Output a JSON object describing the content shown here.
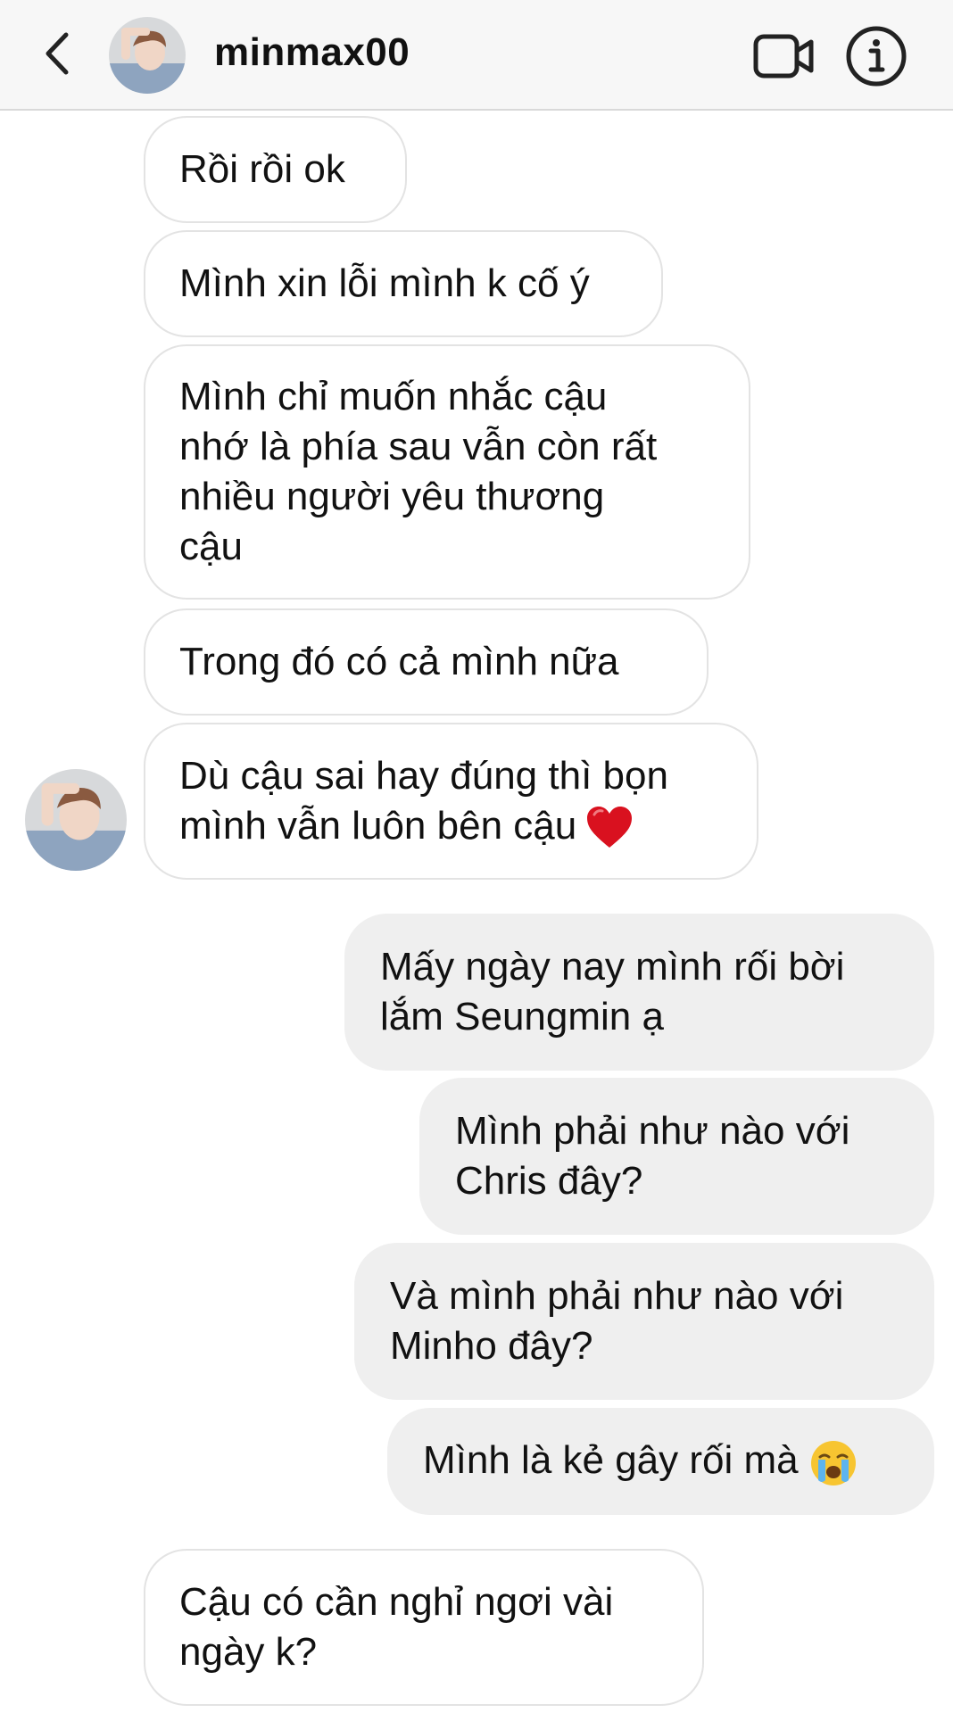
{
  "header": {
    "username": "minmax00",
    "icons": [
      "chevron-left-icon",
      "video-camera-icon",
      "info-icon"
    ]
  },
  "messages": [
    {
      "direction": "incoming",
      "text": "Rồi rồi ok"
    },
    {
      "direction": "incoming",
      "text": "Mình xin lỗi mình k cố ý"
    },
    {
      "direction": "incoming",
      "text": "Mình chỉ muốn nhắc cậu\nnhớ là phía sau vẫn còn rất\nnhiều người yêu thương\ncậu"
    },
    {
      "direction": "incoming",
      "text": "Trong đó có cả mình nữa"
    },
    {
      "direction": "incoming",
      "text": "Dù cậu sai hay đúng thì bọn\nmình vẫn luôn bên cậu",
      "emoji": "heart-emoji"
    },
    {
      "direction": "outgoing",
      "text": "Mấy ngày nay mình rối bời\nlắm Seungmin ạ"
    },
    {
      "direction": "outgoing",
      "text": "Mình phải như nào với\nChris đây?"
    },
    {
      "direction": "outgoing",
      "text": "Và mình phải như nào với\nMinho đây?"
    },
    {
      "direction": "outgoing",
      "text": "Mình là kẻ gây rối mà",
      "emoji": "crying-face-emoji"
    },
    {
      "direction": "incoming",
      "text": "Cậu có cần nghỉ ngơi vài\nngày k?"
    }
  ],
  "colors": {
    "header_bg": "#f7f7f7",
    "incoming_bubble_bg": "#ffffff",
    "incoming_bubble_border": "#e3e3e3",
    "outgoing_bubble_bg": "#efefef",
    "heart": "#d9111f"
  }
}
